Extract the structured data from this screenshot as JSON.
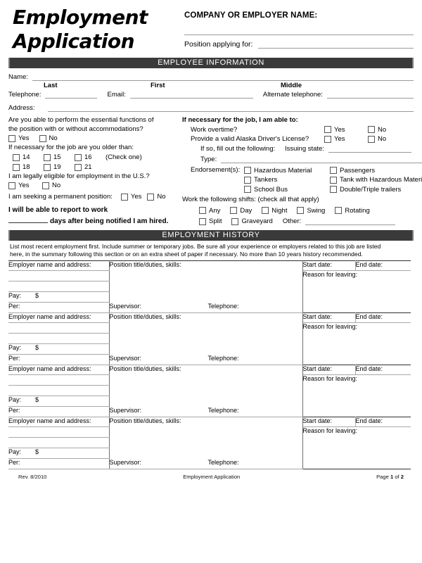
{
  "document": {
    "title_line1": "Employment",
    "title_line2": "Application",
    "company_label": "COMPANY OR EMPLOYER NAME:",
    "position_label": "Position applying for:"
  },
  "sections": {
    "employee_information": "EMPLOYEE INFORMATION",
    "employment_history": "EMPLOYMENT HISTORY"
  },
  "employee_info": {
    "name_label": "Name:",
    "name_sub_last": "Last",
    "name_sub_first": "First",
    "name_sub_middle": "Middle",
    "telephone_label": "Telephone:",
    "email_label": "Email:",
    "alt_telephone_label": "Alternate telephone:",
    "address_label": "Address:",
    "essential_functions_q_line1": "Are you able to perform the essential functions of",
    "essential_functions_q_line2": "the position with or without accommodations?",
    "yes": "Yes",
    "no": "No",
    "older_than_label": "If necessary for the job are you older than:",
    "ages_row1": [
      "14",
      "15",
      "16"
    ],
    "check_one": "(Check one)",
    "ages_row2": [
      "18",
      "19",
      "21"
    ],
    "eligible_label": "I am legally eligible for employment in the U.S.?",
    "permanent_label": "I am seeking a permanent position:",
    "report_line1": "I will be able to report to work",
    "report_line2": "days after being notified I am hired."
  },
  "job_requirements": {
    "heading": "If necessary for the job, I am able to:",
    "overtime_label": "Work overtime?",
    "license_label": "Provide a valid Alaska Driver's License?",
    "if_so_label": "If so, fill out the following:",
    "issuing_state_label": "Issuing state:",
    "type_label": "Type:",
    "endorsements_label": "Endorsement(s):",
    "endorsements": [
      [
        "Hazardous Material",
        "Passengers"
      ],
      [
        "Tankers",
        "Tank with Hazardous Materials"
      ],
      [
        "School Bus",
        "Double/Triple trailers"
      ]
    ],
    "shifts_label": "Work the following shifts: (check all that apply)",
    "shifts_row1": [
      "Any",
      "Day",
      "Night",
      "Swing",
      "Rotating"
    ],
    "shifts_row2": [
      "Split",
      "Graveyard"
    ],
    "other_label": "Other:",
    "yes": "Yes",
    "no": "No"
  },
  "employment_history": {
    "instructions_line1": "List most recent employment first. Include summer or temporary jobs. Be sure all your experience or employers related to this job are listed",
    "instructions_line2": "here, in the summary following this section or on an extra sheet of paper if necessary. No more than 10 years history recommended.",
    "labels": {
      "employer": "Employer name and address:",
      "position": "Position title/duties, skills:",
      "start_date": "Start date:",
      "end_date": "End date:",
      "reason": "Reason for leaving:",
      "pay": "Pay:",
      "dollar": "$",
      "per": "Per:",
      "supervisor": "Supervisor:",
      "telephone": "Telephone:"
    },
    "block_count": 4
  },
  "footer": {
    "revision": "Rev. 8/2010",
    "center": "Employment Application",
    "page_prefix": "Page ",
    "page_number": "1",
    "page_middle": " of ",
    "page_total": "2"
  },
  "colors": {
    "section_bar_bg": "#3a3a3a",
    "section_bar_border": "#7d7d7d",
    "rule": "#9a9a9a",
    "table_block_rule": "#2f2f2f"
  }
}
